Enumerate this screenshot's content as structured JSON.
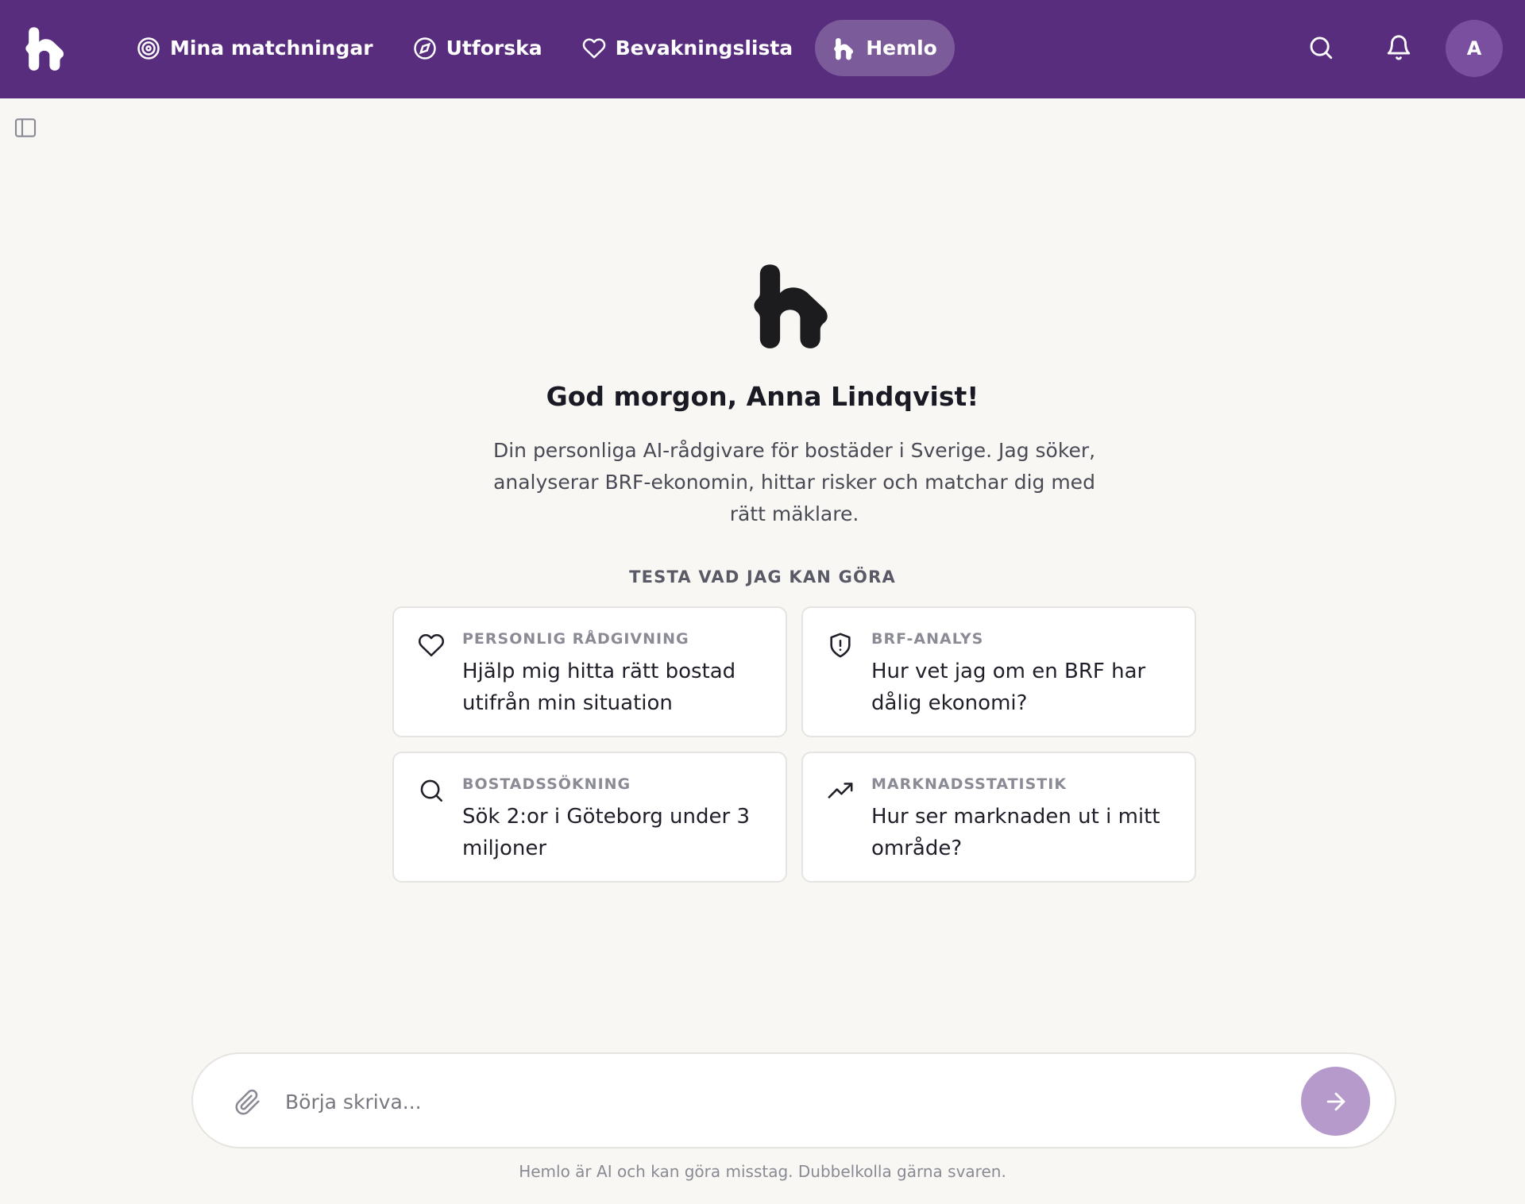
{
  "brand": {
    "logo_icon": "hemlo-logo-icon"
  },
  "nav": {
    "items": [
      {
        "label": "Mina matchningar",
        "icon": "target-icon",
        "active": false
      },
      {
        "label": "Utforska",
        "icon": "compass-icon",
        "active": false
      },
      {
        "label": "Bevakningslista",
        "icon": "heart-icon",
        "active": false
      },
      {
        "label": "Hemlo",
        "icon": "hemlo-logo-icon",
        "active": true
      }
    ]
  },
  "header_actions": {
    "search_icon": "search-icon",
    "bell_icon": "bell-icon",
    "avatar_initial": "A"
  },
  "main": {
    "greeting": "God morgon, Anna Lindqvist!",
    "intro": "Din personliga AI-rådgivare för bostäder i Sverige. Jag söker, analyserar BRF-ekonomin, hittar risker och matchar dig med rätt mäklare.",
    "try_label": "TESTA VAD JAG KAN GÖRA",
    "cards": [
      {
        "category": "PERSONLIG RÅDGIVNING",
        "question": "Hjälp mig hitta rätt bostad utifrån min situation",
        "icon": "heart-icon"
      },
      {
        "category": "BRF-ANALYS",
        "question": "Hur vet jag om en BRF har dålig ekonomi?",
        "icon": "shield-alert-icon"
      },
      {
        "category": "BOSTADSSÖKNING",
        "question": "Sök 2:or i Göteborg under 3 miljoner",
        "icon": "search-icon"
      },
      {
        "category": "MARKNADSSTATISTIK",
        "question": "Hur ser marknaden ut i mitt område?",
        "icon": "trending-up-icon"
      }
    ]
  },
  "composer": {
    "placeholder": "Börja skriva...",
    "value": ""
  },
  "disclaimer": "Hemlo är AI och kan göra misstag. Dubbelkolla gärna svaren.",
  "colors": {
    "header_bg": "#582d7e",
    "page_bg": "#f8f7f4",
    "send_button": "#b69acc"
  }
}
